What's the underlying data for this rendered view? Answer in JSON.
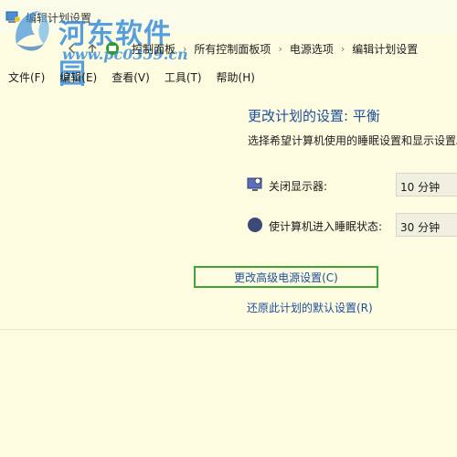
{
  "window": {
    "title": "编辑计划设置"
  },
  "watermark": {
    "brand_text": "河东软件园",
    "url_text": "www.pc0359.cn"
  },
  "address_bar": {
    "breadcrumbs": [
      "控制面板",
      "所有控制面板项",
      "电源选项",
      "编辑计划设置"
    ],
    "separator": "›"
  },
  "menu": {
    "items": [
      "文件(F)",
      "编辑(E)",
      "查看(V)",
      "工具(T)",
      "帮助(H)"
    ]
  },
  "content": {
    "title": "更改计划的设置: 平衡",
    "description": "选择希望计算机使用的睡眠设置和显示设置。",
    "settings": [
      {
        "label": "关闭显示器:",
        "value": "10 分钟",
        "icon": "monitor-power-icon"
      },
      {
        "label": "使计算机进入睡眠状态:",
        "value": "30 分钟",
        "icon": "sleep-moon-icon"
      }
    ],
    "advanced_link": "更改高级电源设置(C)",
    "restore_link": "还原此计划的默认设置(R)"
  },
  "colors": {
    "background": "#fdfce0",
    "link": "#1e4e9c",
    "highlight_border": "#3fa33a"
  }
}
